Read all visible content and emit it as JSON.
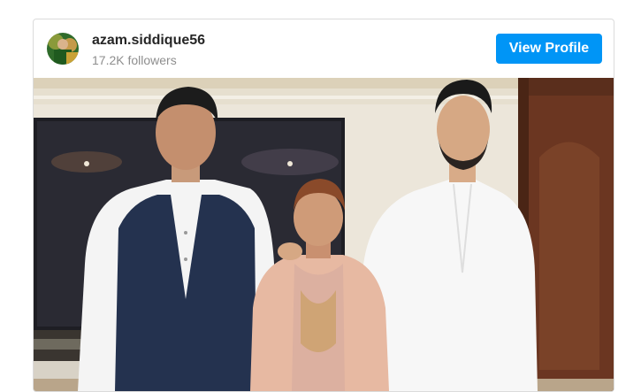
{
  "profile": {
    "username": "azam.siddique56",
    "followers": "17.2K followers",
    "button_label": "View Profile"
  },
  "post": {
    "image": "photo-of-three-people-standing-in-living-room"
  },
  "colors": {
    "button_bg": "#0095f6",
    "button_text": "#ffffff",
    "username": "#262626",
    "muted": "#8e8e8e",
    "border": "#dbdbdb"
  }
}
